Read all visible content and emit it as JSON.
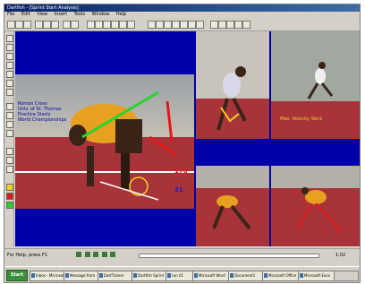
{
  "app": {
    "title": "Dartfish - [Sprint Start Analysis]",
    "menu": [
      "File",
      "Edit",
      "View",
      "Insert",
      "Tools",
      "Window",
      "Help"
    ]
  },
  "overlay": {
    "athlete_info": [
      "Roman Cross",
      "Univ. of St. Thomas",
      "Practice Starts",
      "World Championships"
    ],
    "angle_top": "178",
    "angle_bottom": "31",
    "caption": "Max. Velocity Work"
  },
  "statusbar": {
    "left_text": "For Help, press F1",
    "right_text": "1:02"
  },
  "taskbar": {
    "start_label": "Start",
    "tasks": [
      "Inbox - Microsoft",
      "Message from",
      "DartTrainer",
      "Dartfish Sprint",
      "run 01",
      "Microsoft Word",
      "Document1",
      "Microsoft Office",
      "Microsoft Exce"
    ]
  },
  "colors": {
    "workspace_bg": "#0000a8",
    "track_red": "#a8343a",
    "line_green": "#28d428",
    "line_red": "#e01818",
    "highlight_yellow": "#f0d020"
  },
  "icons": [
    "open-icon",
    "save-icon",
    "print-icon",
    "cut-icon",
    "copy-icon",
    "paste-icon",
    "undo-icon",
    "redo-icon",
    "zoom-icon",
    "grid-icon",
    "play-icon",
    "pause-icon",
    "stop-icon",
    "record-icon",
    "angle-tool-icon",
    "line-tool-icon",
    "circle-tool-icon",
    "text-tool-icon"
  ]
}
